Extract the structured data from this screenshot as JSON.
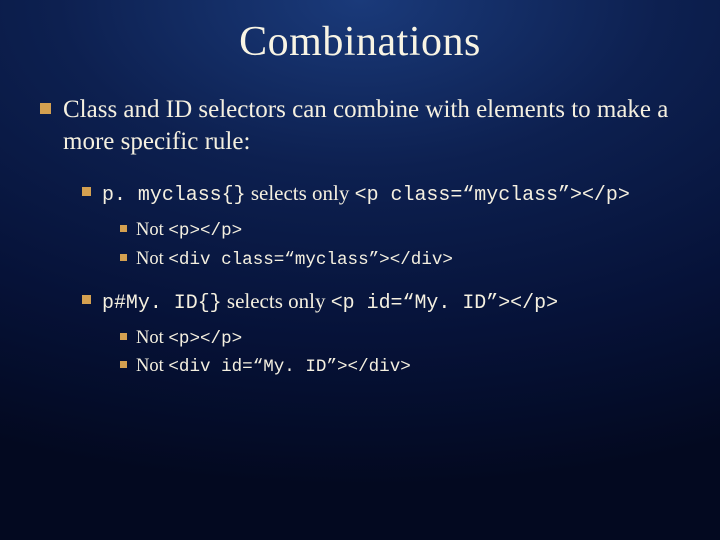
{
  "title": "Combinations",
  "point1": "Class and ID selectors can combine with elements to make a more specific rule:",
  "sub1": {
    "code_a": "p. myclass{}",
    "mid": " selects only ",
    "code_b": "<p class=“myclass”></p>",
    "not1_a": "Not ",
    "not1_b": "<p></p>",
    "not2_a": "Not ",
    "not2_b": "<div class=“myclass”></div>"
  },
  "sub2": {
    "code_a": "p#My. ID{}",
    "mid": " selects only ",
    "code_b": "<p id=“My. ID”></p>",
    "not1_a": "Not ",
    "not1_b": "<p></p>",
    "not2_a": "Not ",
    "not2_b": "<div id=“My. ID”></div>"
  }
}
